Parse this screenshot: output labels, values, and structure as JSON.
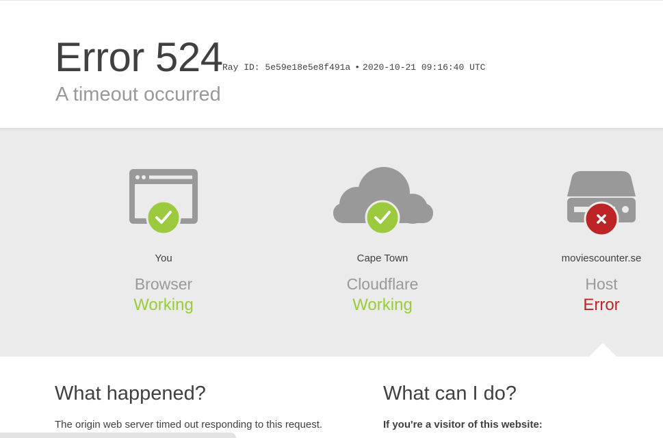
{
  "header": {
    "error_code": "Error 524",
    "ray_id": "Ray ID: 5e59e18e5e8f491a",
    "separator": "•",
    "timestamp": "2020-10-21 09:16:40 UTC",
    "subtitle": "A timeout occurred"
  },
  "status": {
    "browser": {
      "location": "You",
      "kind": "Browser",
      "state": "Working",
      "icon": "browser-icon",
      "badge": "check-icon"
    },
    "cloudflare": {
      "location": "Cape Town",
      "kind": "Cloudflare",
      "state": "Working",
      "icon": "cloud-icon",
      "badge": "check-icon"
    },
    "host": {
      "location": "moviescounter.se",
      "kind": "Host",
      "state": "Error",
      "icon": "server-icon",
      "badge": "x-icon"
    }
  },
  "info": {
    "what_happened": {
      "heading": "What happened?",
      "text": "The origin web server timed out responding to this request."
    },
    "what_can_i_do": {
      "heading": "What can I do?",
      "subheading": "If you're a visitor of this website:"
    }
  },
  "colors": {
    "ok": "#9bca3e",
    "error": "#bd2426",
    "icon_gray": "#999999",
    "band": "#ebebeb"
  }
}
